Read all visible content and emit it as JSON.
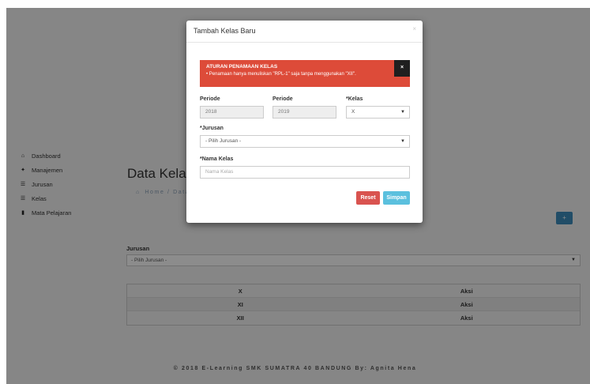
{
  "sidebar": {
    "items": [
      {
        "icon": "home-icon",
        "glyph": "⌂",
        "label": "Dashboard"
      },
      {
        "icon": "users-icon",
        "glyph": "✦",
        "label": "Manajemen"
      },
      {
        "icon": "list-icon",
        "glyph": "☰",
        "label": "Jurusan"
      },
      {
        "icon": "list-icon",
        "glyph": "☰",
        "label": "Kelas"
      },
      {
        "icon": "book-icon",
        "glyph": "▮",
        "label": "Mata Pelajaran"
      }
    ]
  },
  "page": {
    "title": "Data Kelas",
    "breadcrumb": {
      "home": "Home",
      "separator": "/",
      "current": "Data Kelas"
    },
    "add_button_glyph": "+"
  },
  "filter": {
    "label": "Jurusan",
    "selected": "- Pilih Jurusan -"
  },
  "table": {
    "rows": [
      {
        "kelas": "X",
        "aksi": "Aksi"
      },
      {
        "kelas": "XI",
        "aksi": "Aksi"
      },
      {
        "kelas": "XII",
        "aksi": "Aksi"
      }
    ]
  },
  "footer": {
    "text": "© 2018 E-Learning SMK SUMATRA 40 BANDUNG By: Agnita Hena"
  },
  "modal": {
    "title": "Tambah Kelas Baru",
    "close_glyph": "×",
    "alert": {
      "title": "ATURAN PENAMAAN KELAS",
      "rule": "Penamaan hanya menuliskan \"RPL-1\" saja tanpa menggunakan \"XII\".",
      "close_glyph": "×"
    },
    "periode_start": {
      "label": "Periode",
      "value": "2018"
    },
    "periode_end": {
      "label": "Periode",
      "value": "2019"
    },
    "kelas": {
      "label": "*Kelas",
      "selected": "X"
    },
    "jurusan": {
      "label": "*Jurusan",
      "selected": "- Pilih Jurusan -"
    },
    "nama_kelas": {
      "label": "*Nama Kelas",
      "placeholder": "Nama Kelas"
    },
    "reset_label": "Reset",
    "save_label": "Simpan"
  },
  "colors": {
    "alert_red": "#dd4b39",
    "primary_blue": "#3c8dbc",
    "reset_red": "#d9534f",
    "save_cyan": "#5bc0de"
  }
}
